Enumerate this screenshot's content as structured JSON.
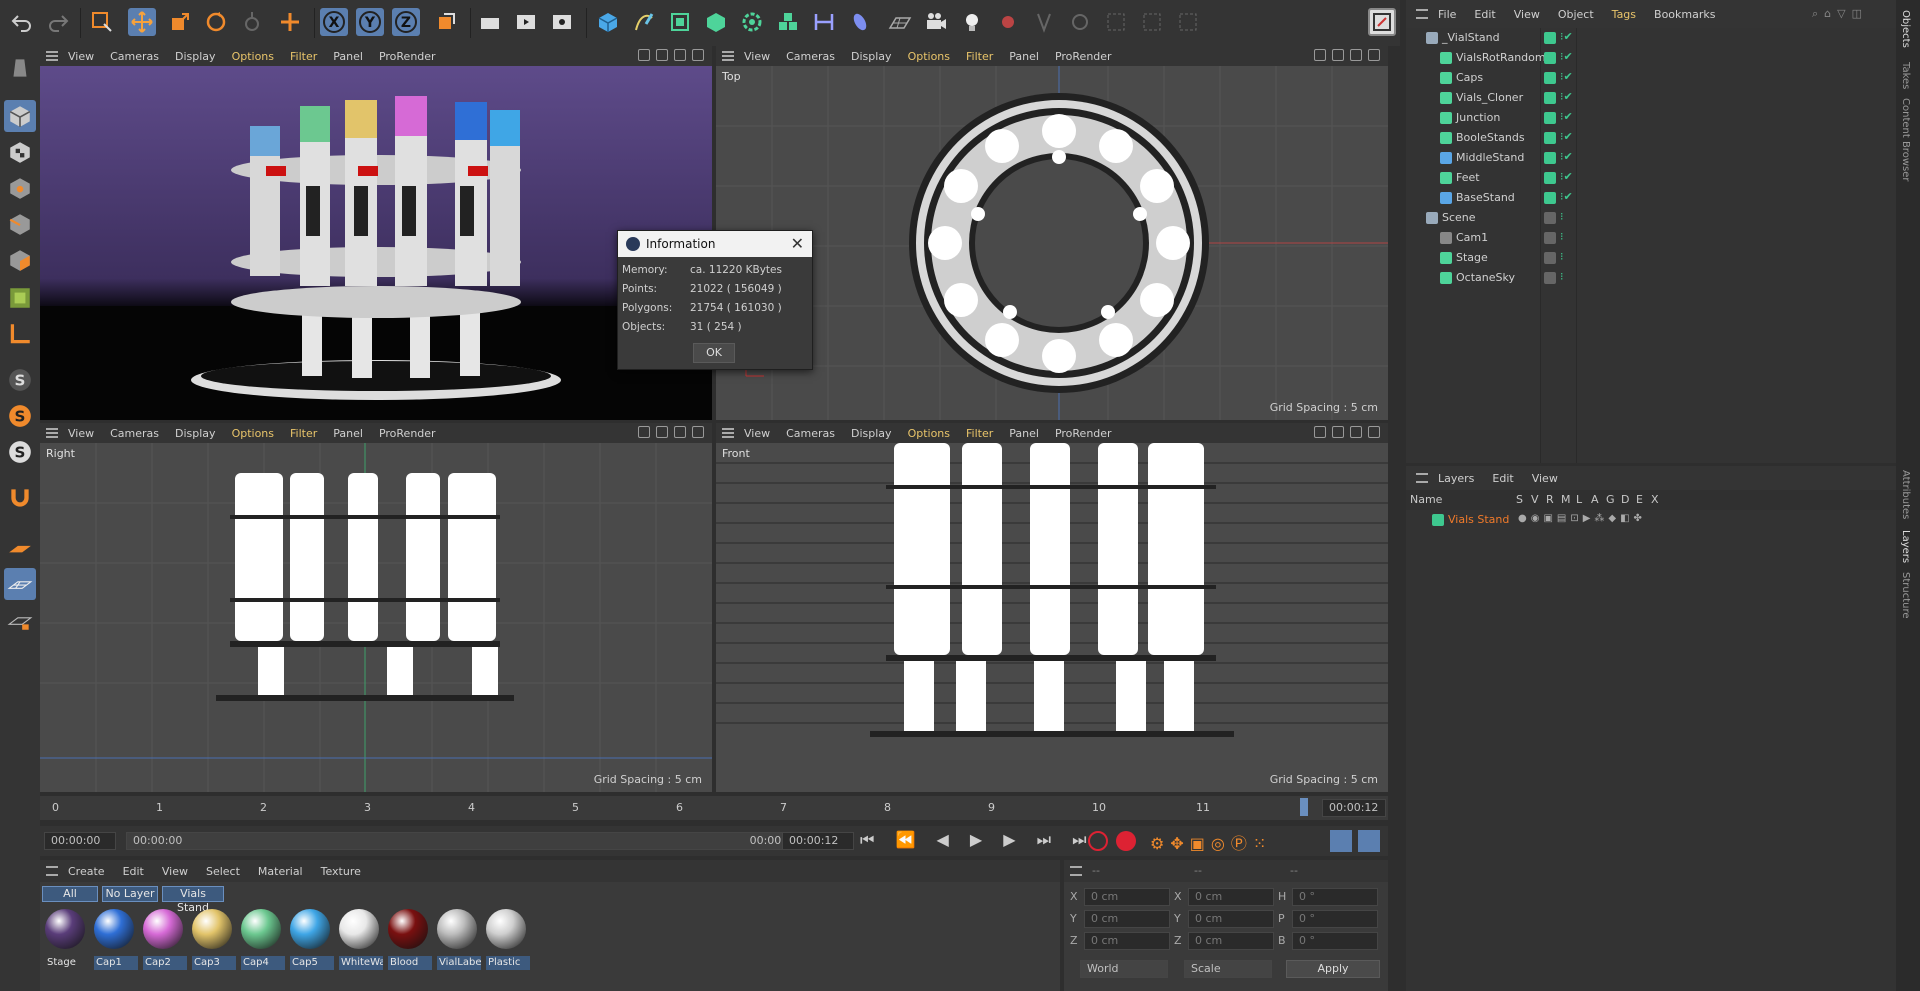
{
  "viewport_menu": [
    "View",
    "Cameras",
    "Display",
    "Options",
    "Filter",
    "Panel",
    "ProRender"
  ],
  "viewports": {
    "persp": {
      "label": ""
    },
    "top": {
      "label": "Top",
      "grid": "Grid Spacing : 5 cm"
    },
    "right": {
      "label": "Right",
      "grid": "Grid Spacing : 5 cm"
    },
    "front": {
      "label": "Front",
      "grid": "Grid Spacing : 5 cm"
    }
  },
  "objects_menu": [
    "File",
    "Edit",
    "View",
    "Object",
    "Tags",
    "Bookmarks"
  ],
  "objects": [
    {
      "name": "_VialStand",
      "indent": 0,
      "icon": "null-icon"
    },
    {
      "name": "VialsRotRandom",
      "indent": 1,
      "icon": "effector-icon"
    },
    {
      "name": "Caps",
      "indent": 1,
      "icon": "cloner-icon"
    },
    {
      "name": "Vials_Cloner",
      "indent": 1,
      "icon": "cloner-icon"
    },
    {
      "name": "Junction",
      "indent": 1,
      "icon": "cloner-icon"
    },
    {
      "name": "BooleStands",
      "indent": 1,
      "icon": "boole-icon"
    },
    {
      "name": "MiddleStand",
      "indent": 1,
      "icon": "cylinder-icon"
    },
    {
      "name": "Feet",
      "indent": 1,
      "icon": "cloner-icon"
    },
    {
      "name": "BaseStand",
      "indent": 1,
      "icon": "cylinder-icon"
    },
    {
      "name": "Scene",
      "indent": 0,
      "icon": "null-icon"
    },
    {
      "name": "Cam1",
      "indent": 1,
      "icon": "camera-icon"
    },
    {
      "name": "Stage",
      "indent": 1,
      "icon": "stage-icon"
    },
    {
      "name": "OctaneSky",
      "indent": 1,
      "icon": "sky-icon"
    }
  ],
  "side_tabs_top": [
    "Objects",
    "Takes",
    "Content Browser"
  ],
  "side_tabs_bottom": [
    "Attributes",
    "Layers",
    "Structure"
  ],
  "layers_menu": [
    "Layers",
    "Edit",
    "View"
  ],
  "layers_columns": [
    "Name",
    "S",
    "V",
    "R",
    "M",
    "L",
    "A",
    "G",
    "D",
    "E",
    "X"
  ],
  "layer": {
    "name": "Vials Stand",
    "color": "#3ec88f"
  },
  "timeline": {
    "ticks": [
      "0",
      "1",
      "2",
      "3",
      "4",
      "5",
      "6",
      "7",
      "8",
      "9",
      "10",
      "11"
    ],
    "current": "00:00:12"
  },
  "transport": {
    "start": "00:00:00",
    "range_start": "00:00:00",
    "range_end": "00:00:12",
    "end": "00:00:12"
  },
  "materials_menu": [
    "Create",
    "Edit",
    "View",
    "Select",
    "Material",
    "Texture"
  ],
  "material_filters": [
    "All",
    "No Layer",
    "Vials Stand"
  ],
  "materials": [
    {
      "name": "Stage",
      "color": "#5a3d7a"
    },
    {
      "name": "Cap1",
      "color": "#2f6fd6"
    },
    {
      "name": "Cap2",
      "color": "#d66ad6"
    },
    {
      "name": "Cap3",
      "color": "#e2c46a"
    },
    {
      "name": "Cap4",
      "color": "#6cc890"
    },
    {
      "name": "Cap5",
      "color": "#3fa6e6"
    },
    {
      "name": "WhiteWall",
      "color": "#e8e8e8"
    },
    {
      "name": "Blood",
      "color": "#7a1010"
    },
    {
      "name": "VialLabel",
      "color": "#bdbdbd"
    },
    {
      "name": "Plastic",
      "color": "#cfcfcf"
    }
  ],
  "coords": {
    "head": [
      "--",
      "--",
      "--"
    ],
    "rows": [
      {
        "a": "X",
        "av": "0 cm",
        "b": "X",
        "bv": "0 cm",
        "c": "H",
        "cv": "0 °"
      },
      {
        "a": "Y",
        "av": "0 cm",
        "b": "Y",
        "bv": "0 cm",
        "c": "P",
        "cv": "0 °"
      },
      {
        "a": "Z",
        "av": "0 cm",
        "b": "Z",
        "bv": "0 cm",
        "c": "B",
        "cv": "0 °"
      }
    ],
    "mode1": "World",
    "mode2": "Scale",
    "apply": "Apply"
  },
  "dialog": {
    "title": "Information",
    "rows": [
      {
        "k": "Memory:",
        "v": "ca. 11220 KBytes"
      },
      {
        "k": "Points:",
        "v": "21022 ( 156049 )"
      },
      {
        "k": "Polygons:",
        "v": "21754 ( 161030 )"
      },
      {
        "k": "Objects:",
        "v": "31 ( 254 )"
      }
    ],
    "ok": "OK"
  },
  "colors": {
    "accent": "#e8c46a",
    "green": "#3ec88f",
    "selection": "#3d5a7e"
  }
}
